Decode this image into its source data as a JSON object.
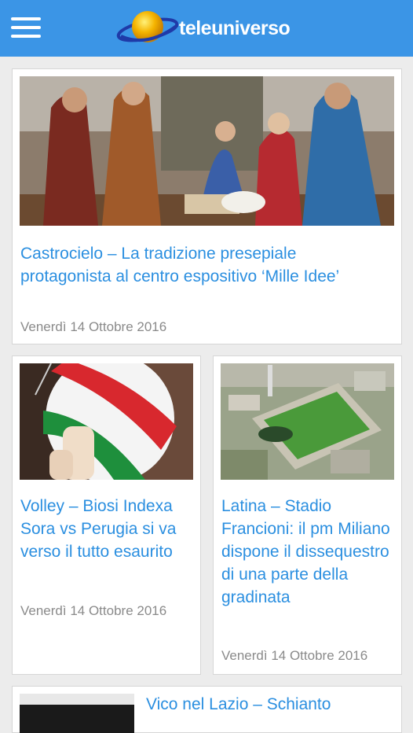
{
  "header": {
    "logo_text": "teleuniverso",
    "menu_icon": "hamburger-menu-icon",
    "bar_color": "#3b95e6"
  },
  "articles": [
    {
      "title": "Castrocielo – La tradizione presepiale protagonista al centro espositivo ‘Mille Idee’",
      "date": "Venerdì 14 Ottobre 2016"
    },
    {
      "title": "Volley – Biosi Indexa Sora vs Perugia si va verso il tutto esaurito",
      "date": "Venerdì 14 Ottobre 2016"
    },
    {
      "title": "Latina – Stadio Francioni: il pm Miliano dispone il dissequestro di una parte della gradinata",
      "date": "Venerdì 14 Ottobre 2016"
    },
    {
      "title": "Vico nel Lazio – Schianto"
    }
  ],
  "colors": {
    "title_link": "#2b8fe0",
    "date_text": "#8a8a8a",
    "background": "#ececec"
  }
}
